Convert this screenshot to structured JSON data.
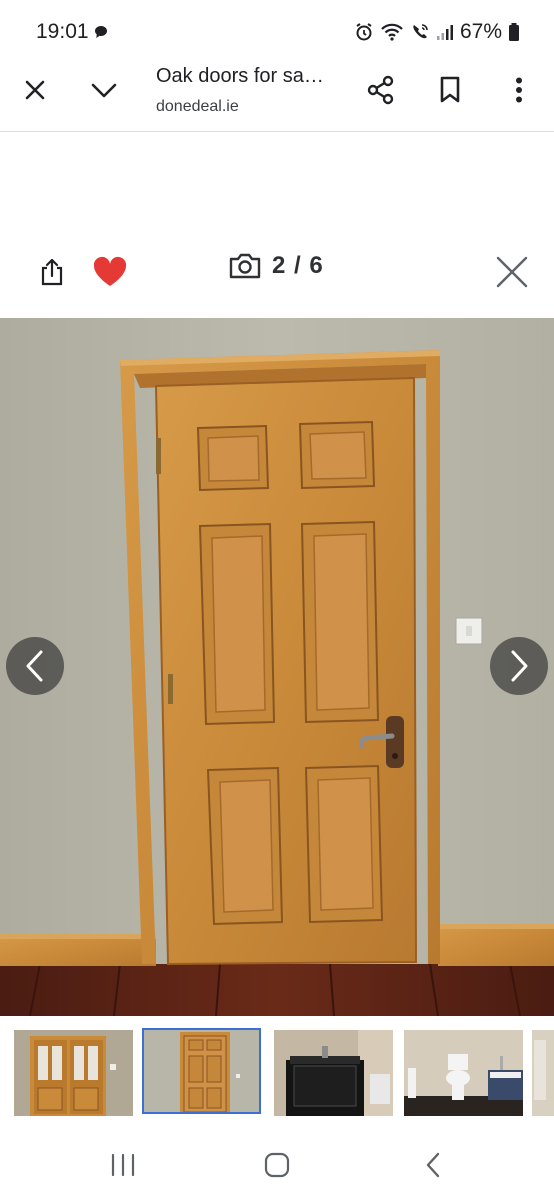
{
  "status_bar": {
    "time": "19:01",
    "battery": "67%",
    "icons": [
      "chat-bubble-icon",
      "alarm-icon",
      "wifi-icon",
      "wifi-call-icon",
      "signal-icon",
      "battery-icon"
    ]
  },
  "browser": {
    "title": "Oak doors for sa…",
    "domain": "donedeal.ie",
    "icons": [
      "close-icon",
      "chevron-down-icon",
      "share-icon",
      "bookmark-icon",
      "more-vert-icon"
    ]
  },
  "gallery": {
    "counter": "2 / 6",
    "current_index": 2,
    "total": 6,
    "favorite_color": "#e53935",
    "icons": [
      "export-icon",
      "heart-icon",
      "camera-icon",
      "close-icon"
    ]
  },
  "photo": {
    "subject": "Oak six-panel door",
    "icons": [
      "chevron-left-icon",
      "chevron-right-icon"
    ]
  },
  "thumbnails": [
    {
      "name": "thumb-glass-double-doors",
      "selected": false
    },
    {
      "name": "thumb-oak-door",
      "selected": true
    },
    {
      "name": "thumb-bathroom-vanity",
      "selected": false
    },
    {
      "name": "thumb-bathroom-toilet",
      "selected": false
    },
    {
      "name": "thumb-partial",
      "selected": false
    }
  ],
  "system_nav": {
    "icons": [
      "recents-icon",
      "home-icon",
      "back-icon"
    ]
  },
  "colors": {
    "accent_selected": "#3b6fd4",
    "oak": "#c98a3a",
    "wall": "#b8b6a8"
  }
}
